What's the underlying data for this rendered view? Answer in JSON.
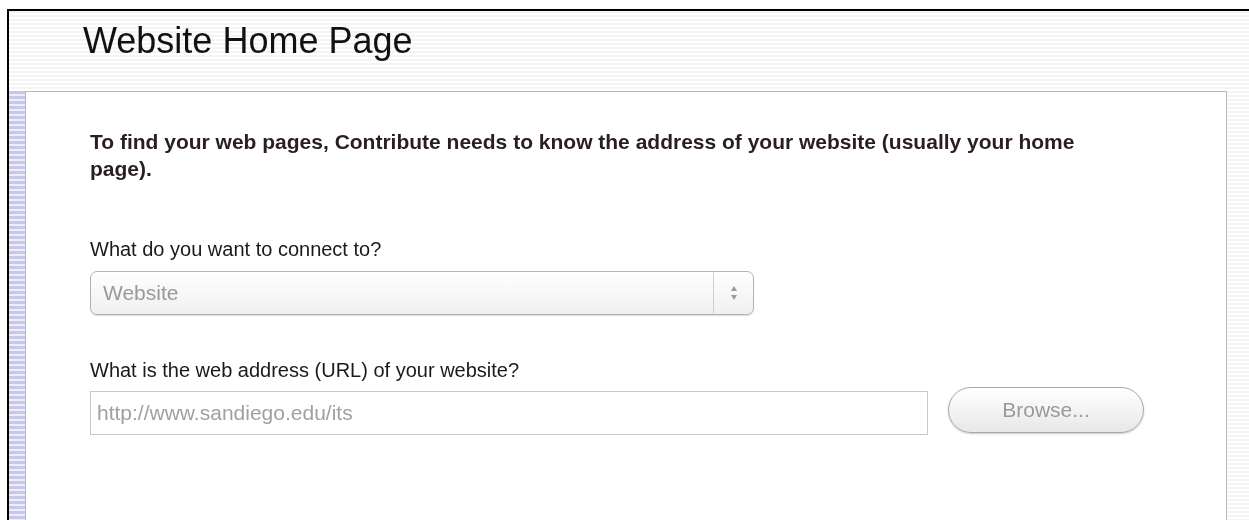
{
  "header": {
    "title": "Website Home Page"
  },
  "panel": {
    "intro": "To find your web pages, Contribute needs to know the address of your website (usually your home page).",
    "connect_question": "What do you want to connect to?",
    "connect_select": {
      "value": "Website",
      "disabled": true
    },
    "url_question": "What is the web address (URL) of your website?",
    "url_field": {
      "value": "http://www.sandiego.edu/its",
      "disabled": true
    },
    "browse_button": {
      "label": "Browse...",
      "disabled": true
    }
  }
}
